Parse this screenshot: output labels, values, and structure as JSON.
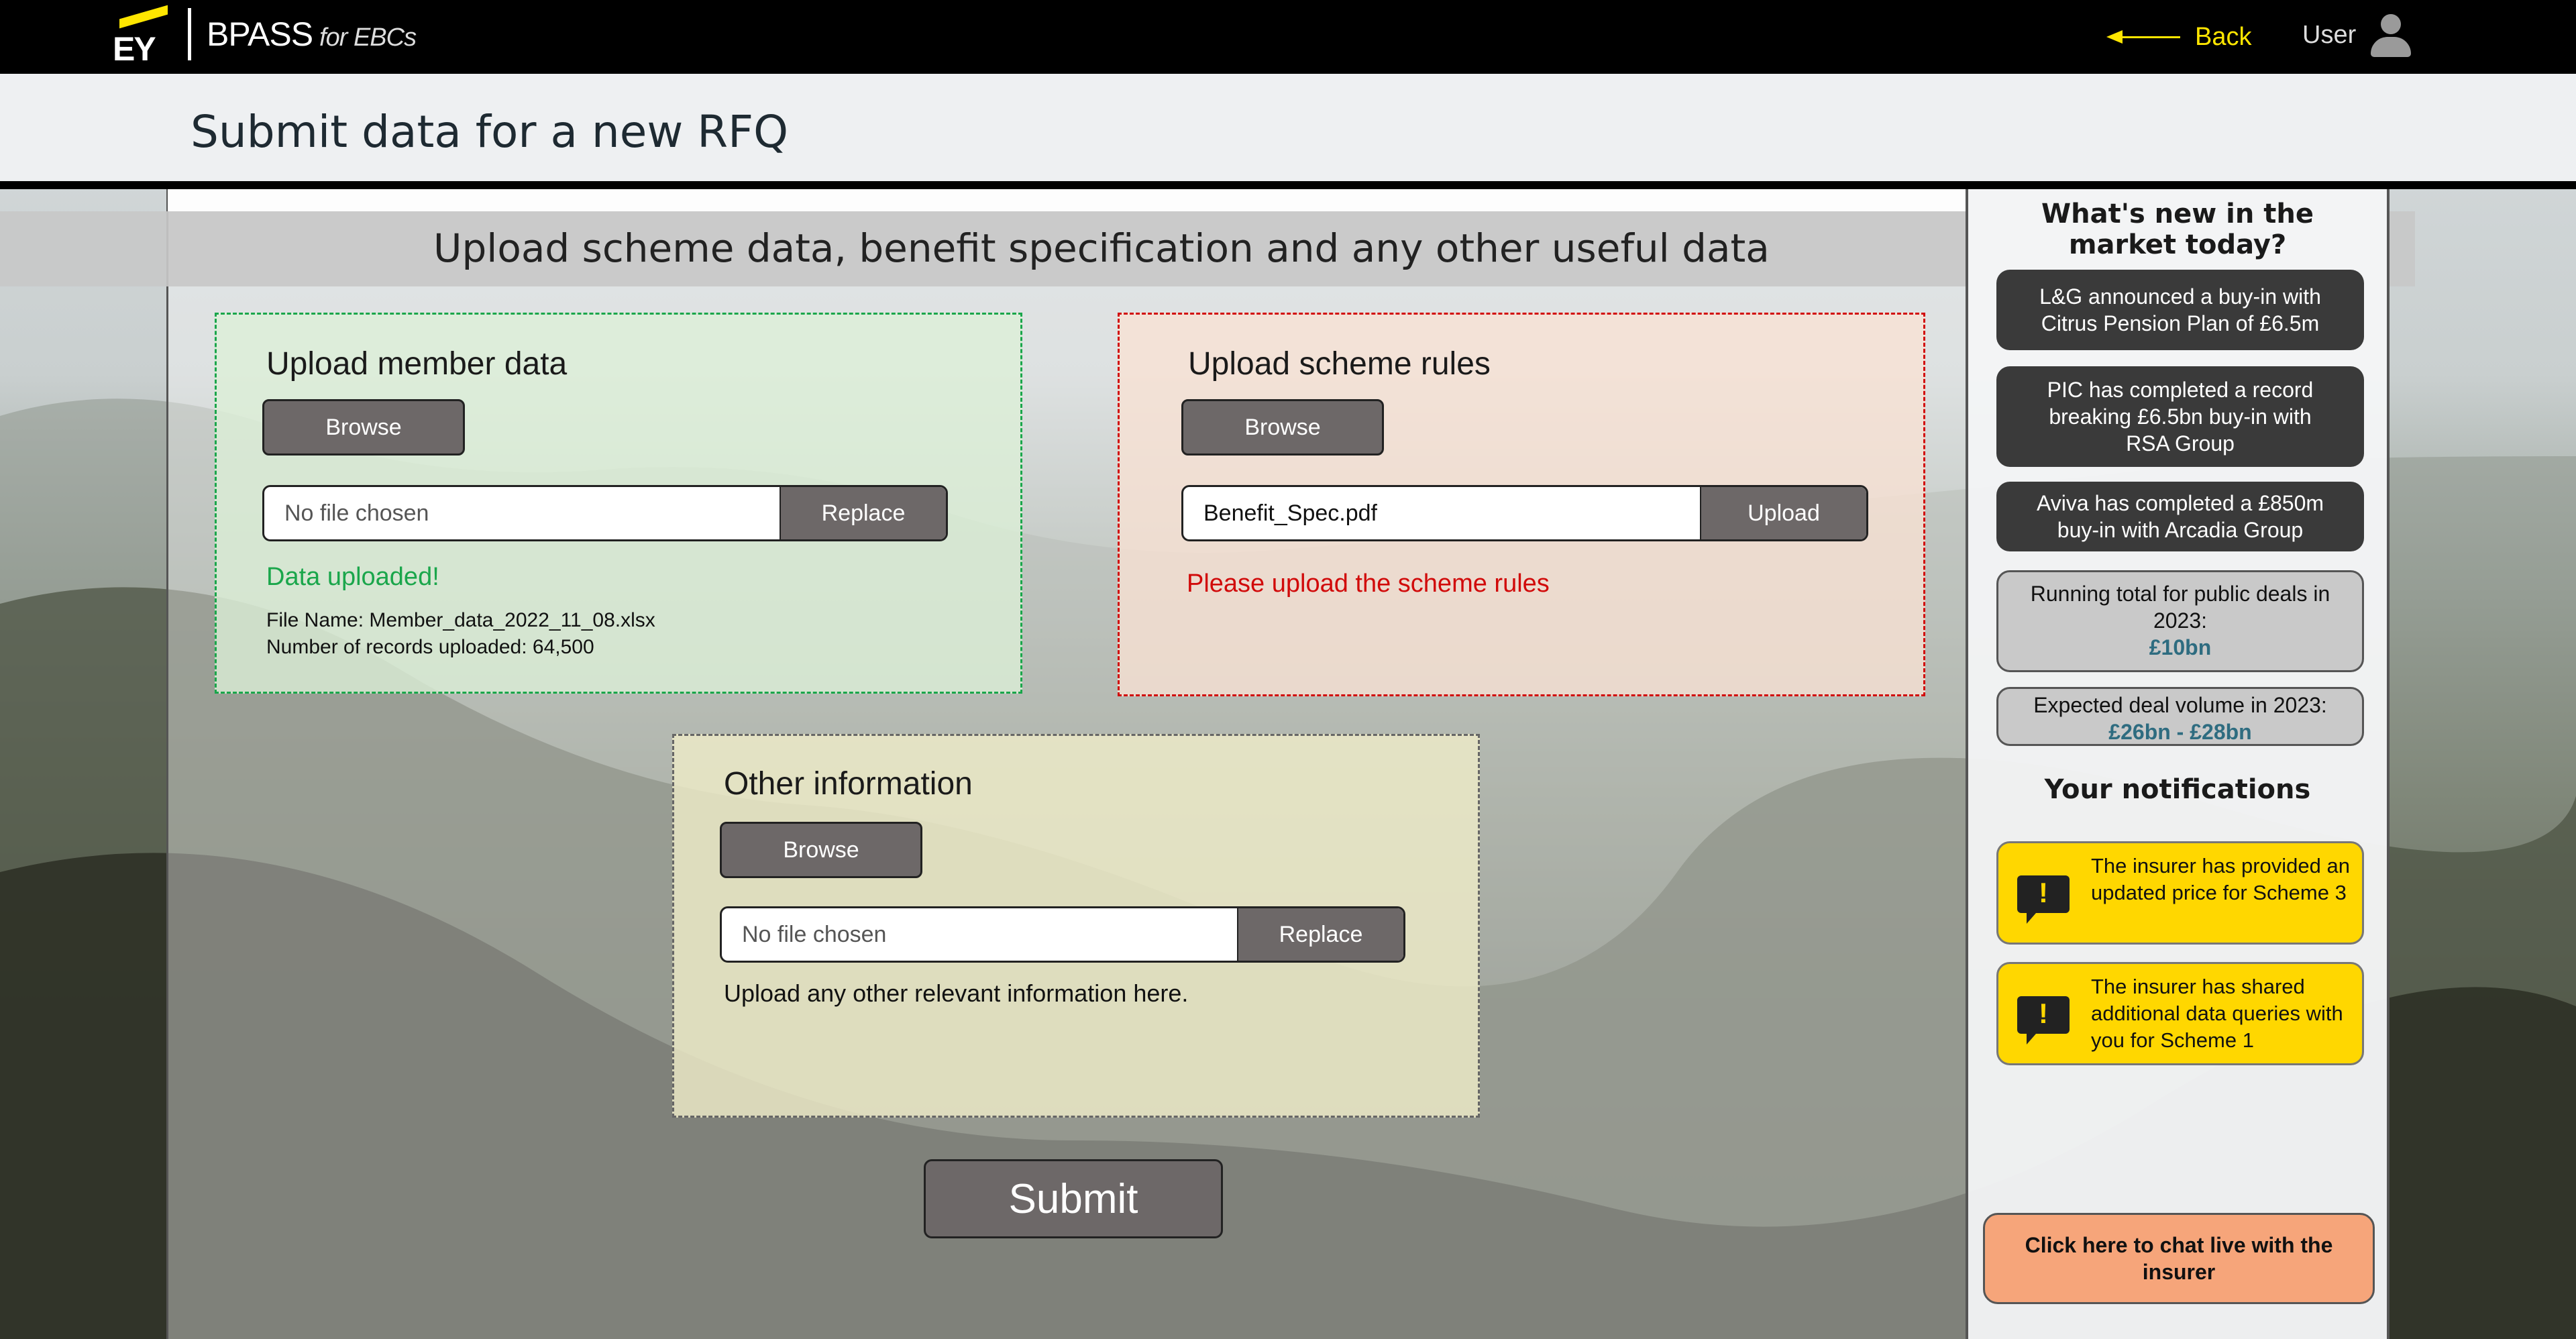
{
  "header": {
    "logo_text": "EY",
    "brand": "BPASS",
    "brand_sub": "for EBCs",
    "back_label": "Back",
    "user_label": "User"
  },
  "page_title": "Submit data for a new RFQ",
  "section_heading": "Upload scheme data, benefit specification and any other useful data",
  "member_data": {
    "title": "Upload member data",
    "browse_label": "Browse",
    "file_value": "No file chosen",
    "action_label": "Replace",
    "status": "Data uploaded!",
    "file_name": "File Name: Member_data_2022_11_08.xlsx",
    "records": "Number of records uploaded: 64,500"
  },
  "scheme_rules": {
    "title": "Upload scheme rules",
    "browse_label": "Browse",
    "file_value": "Benefit_Spec.pdf",
    "action_label": "Upload",
    "error": "Please upload the scheme rules"
  },
  "other_info": {
    "title": "Other information",
    "browse_label": "Browse",
    "file_value": "No file chosen",
    "action_label": "Replace",
    "hint": "Upload any other relevant information here."
  },
  "submit_label": "Submit",
  "sidebar": {
    "market_heading": "What's new in the market today?",
    "news": [
      "L&G announced a buy-in with Citrus Pension Plan of £6.5m",
      "PIC has completed a record breaking £6.5bn buy-in with RSA Group",
      "Aviva has completed a £850m buy-in with Arcadia Group"
    ],
    "stats": [
      {
        "label": "Running total for public deals in 2023:",
        "value": "£10bn"
      },
      {
        "label": "Expected deal volume in 2023:",
        "value": "£26bn - £28bn"
      }
    ],
    "notifications_heading": "Your notifications",
    "notifications": [
      "The insurer has provided an updated price for Scheme 3",
      "The insurer has shared additional data queries with you for Scheme 1"
    ],
    "chat_label": "Click here to chat live with the insurer"
  }
}
